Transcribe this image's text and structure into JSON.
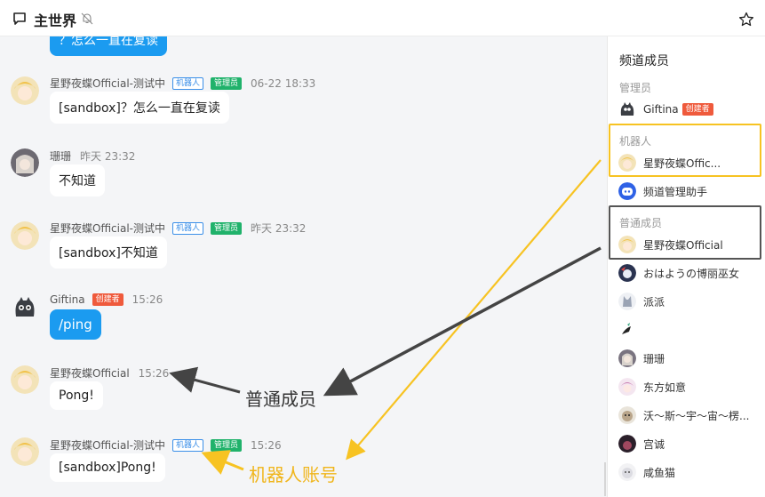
{
  "header": {
    "title": "主世界"
  },
  "chat": {
    "top_partial_text": "？怎么一直在复读",
    "messages": [
      {
        "name": "星野夜蝶Official-测试中",
        "tags": [
          "机器人",
          "管理员"
        ],
        "time": "06-22 18:33",
        "text": "[sandbox]？怎么一直在复读"
      },
      {
        "name": "珊珊",
        "tags": [],
        "time": "昨天 23:32",
        "text": "不知道"
      },
      {
        "name": "星野夜蝶Official-测试中",
        "tags": [
          "机器人",
          "管理员"
        ],
        "time": "昨天 23:32",
        "text": "[sandbox]不知道"
      },
      {
        "name": "Giftina",
        "tags": [
          "创建者"
        ],
        "time": "15:26",
        "text": "/ping"
      },
      {
        "name": "星野夜蝶Official",
        "tags": [],
        "time": "15:26",
        "text": "Pong!"
      },
      {
        "name": "星野夜蝶Official-测试中",
        "tags": [
          "机器人",
          "管理员"
        ],
        "time": "15:26",
        "text": "[sandbox]Pong!"
      }
    ]
  },
  "sidebar": {
    "title": "频道成员",
    "groups": {
      "admin": "管理员",
      "bot": "机器人",
      "member": "普通成员"
    },
    "members": [
      {
        "name": "Giftina",
        "tag": "创建者"
      },
      {
        "name": "星野夜蝶Offic..."
      },
      {
        "name": "频道管理助手"
      },
      {
        "name": "星野夜蝶Official"
      },
      {
        "name": "おはようの博丽巫女"
      },
      {
        "name": "派派"
      },
      {
        "name": ""
      },
      {
        "name": "珊珊"
      },
      {
        "name": "东方如意"
      },
      {
        "name": "沃～斯～宇～宙～楞..."
      },
      {
        "name": "宫诚"
      },
      {
        "name": "咸鱼猫"
      }
    ]
  },
  "annotations": {
    "member_label": "普通成员",
    "bot_label": "机器人账号"
  },
  "colors": {
    "accent_blue": "#1b9bf0",
    "bot_tag": "#3b8fe8",
    "admin_tag": "#20b26b",
    "creator_tag": "#ef5a3c",
    "annotation_yellow": "#f7c322",
    "annotation_dark": "#444444"
  },
  "icons": [
    "chat-icon",
    "mute-bell-icon",
    "star-icon"
  ]
}
